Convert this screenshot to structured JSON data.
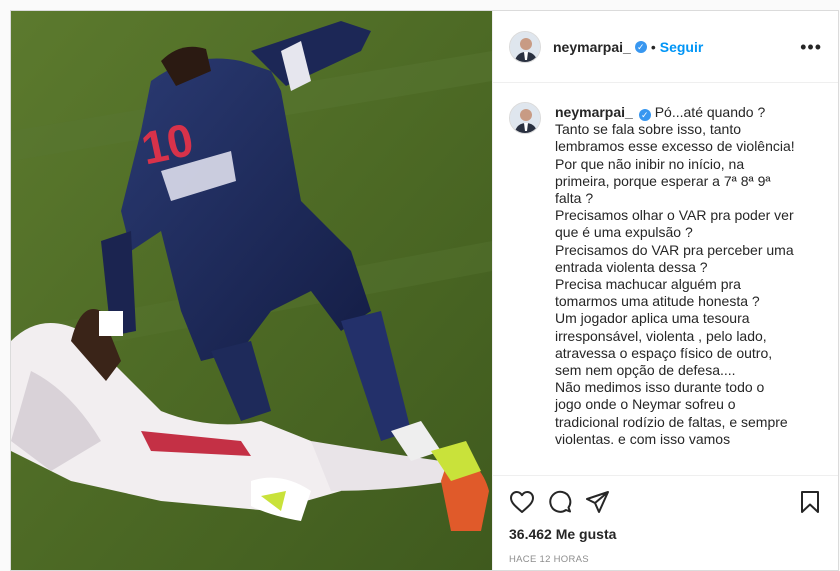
{
  "post": {
    "username": "neymarpai_",
    "follow_label": "Seguir",
    "separator": "•",
    "more_label": "•••",
    "caption_lines": [
      "Pó...até quando ?",
      "Tanto se fala sobre isso, tanto",
      "lembramos esse excesso de violência!",
      "Por que não inibir no início, na",
      "primeira, porque esperar a 7ª 8ª 9ª",
      "falta ?",
      "Precisamos olhar o VAR pra poder ver",
      "que é uma expulsão ?",
      "Precisamos do VAR pra perceber uma",
      "entrada violenta dessa ?",
      "Precisa machucar alguém pra",
      "tomarmos uma atitude honesta ?",
      "Um jogador aplica uma tesoura",
      "irresponsável, violenta , pelo lado,",
      "atravessa o espaço físico de outro,",
      "sem nem opção de defesa....",
      "Não medimos isso durante todo o",
      "jogo onde o Neymar sofreu o",
      "tradicional rodízio de faltas, e sempre",
      "violentas. e com isso vamos"
    ],
    "likes_label": "36.462 Me gusta",
    "time_label": "HACE 12 HORAS",
    "jersey_number": "10"
  },
  "icons": {
    "like": "heart-icon",
    "comment": "comment-icon",
    "share": "paper-plane-icon",
    "save": "bookmark-icon",
    "verified": "verified-badge-icon"
  },
  "colors": {
    "link": "#0095f6",
    "verified": "#3897f0",
    "text": "#262626",
    "muted": "#8e8e8e"
  }
}
